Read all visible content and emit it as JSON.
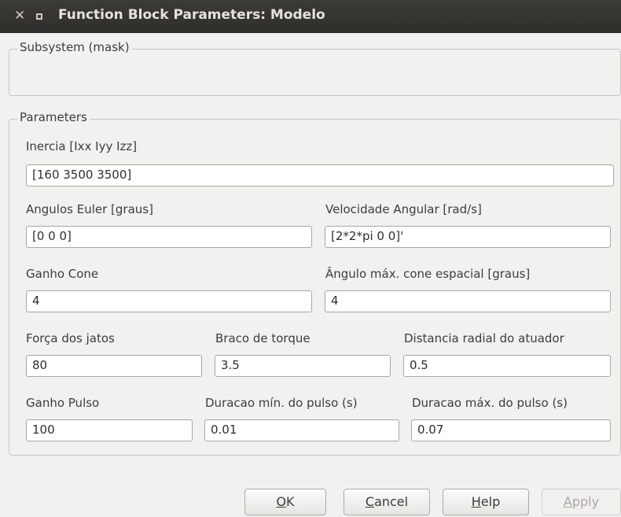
{
  "window": {
    "title": "Function Block Parameters: Modelo"
  },
  "icons": {
    "close": "close-icon",
    "maximize": "maximize-icon"
  },
  "description_group": {
    "legend": "Subsystem (mask)"
  },
  "parameters_group": {
    "legend": "Parameters",
    "fields": {
      "inercia": {
        "label": "Inercia [Ixx Iyy Izz]",
        "value": "[160 3500 3500]"
      },
      "angulos_euler": {
        "label": "Angulos Euler [graus]",
        "value": "[0 0 0]"
      },
      "velocidade_angular": {
        "label": "Velocidade Angular [rad/s]",
        "value": "[2*2*pi 0 0]'"
      },
      "ganho_cone": {
        "label": "Ganho Cone",
        "value": "4"
      },
      "angulo_max_cone": {
        "label": "Ângulo máx. cone espacial [graus]",
        "value": "4"
      },
      "forca_jatos": {
        "label": "Força dos jatos",
        "value": "80"
      },
      "braco_torque": {
        "label": "Braco de torque",
        "value": "3.5"
      },
      "distancia_radial": {
        "label": "Distancia radial do atuador",
        "value": "0.5"
      },
      "ganho_pulso": {
        "label": "Ganho Pulso",
        "value": "100"
      },
      "duracao_min_pulso": {
        "label": "Duracao mín. do pulso (s)",
        "value": "0.01"
      },
      "duracao_max_pulso": {
        "label": "Duracao máx. do pulso (s)",
        "value": "0.07"
      }
    }
  },
  "buttons": {
    "ok": {
      "mnemonic": "O",
      "rest": "K"
    },
    "cancel": {
      "mnemonic": "C",
      "rest": "ancel"
    },
    "help": {
      "mnemonic": "H",
      "rest": "elp"
    },
    "apply": {
      "mnemonic": "A",
      "rest": "pply",
      "state": "disabled"
    }
  }
}
